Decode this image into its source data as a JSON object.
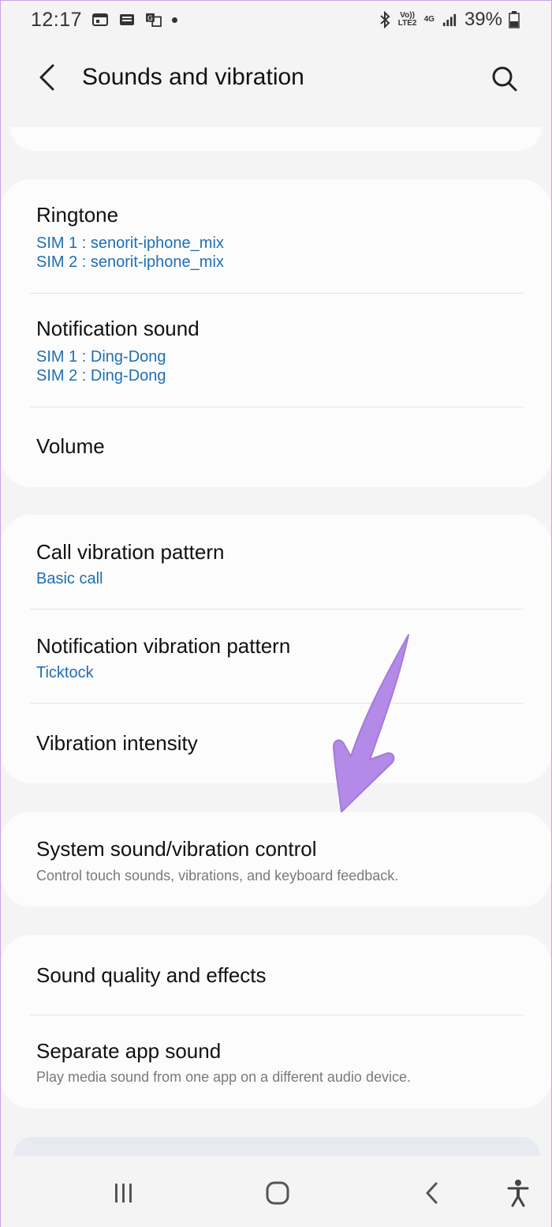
{
  "status_bar": {
    "time": "12:17",
    "volte": "Vo)) LTE2",
    "network": "4G",
    "battery": "39%",
    "icons": [
      "calendar-icon",
      "message-icon",
      "translate-icon",
      "dot-icon",
      "bluetooth-icon",
      "signal-icon",
      "battery-icon"
    ]
  },
  "app_bar": {
    "title": "Sounds and vibration",
    "icons": [
      "back-arrow-icon",
      "search-icon"
    ]
  },
  "groups": [
    {
      "items": [
        {
          "title": "Ringtone",
          "sub": [
            "SIM 1 : senorit-iphone_mix",
            "SIM 2 : senorit-iphone_mix"
          ]
        },
        {
          "title": "Notification sound",
          "sub": [
            "SIM 1 : Ding-Dong",
            "SIM 2 : Ding-Dong"
          ]
        },
        {
          "title": "Volume"
        }
      ]
    },
    {
      "items": [
        {
          "title": "Call vibration pattern",
          "sub": [
            "Basic call"
          ]
        },
        {
          "title": "Notification vibration pattern",
          "sub": [
            "Ticktock"
          ]
        },
        {
          "title": "Vibration intensity"
        }
      ]
    },
    {
      "items": [
        {
          "title": "System sound/vibration control",
          "desc": "Control touch sounds, vibrations, and keyboard feedback."
        }
      ]
    },
    {
      "items": [
        {
          "title": "Sound quality and effects"
        },
        {
          "title": "Separate app sound",
          "desc": "Play media sound from one app on a different audio device."
        }
      ]
    }
  ],
  "nav_bar": {
    "icons": [
      "recents-icon",
      "home-icon",
      "back-icon",
      "accessibility-icon"
    ]
  },
  "colors": {
    "background": "#f4f4f4",
    "card": "#fcfcfc",
    "accent_text": "#1f6fb5",
    "annotation_arrow": "#b07fe6"
  }
}
